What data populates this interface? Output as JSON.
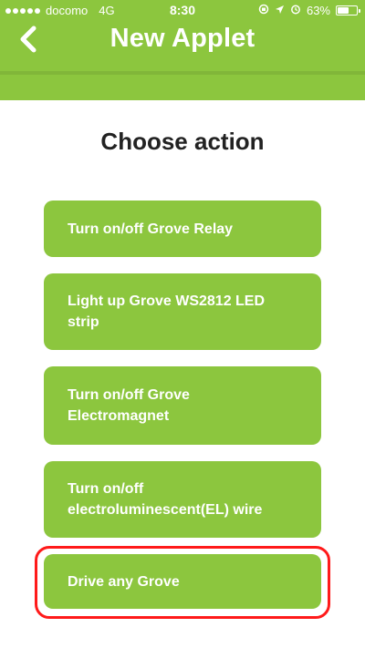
{
  "colors": {
    "brand": "#8cc63e",
    "highlight": "#ff1a1a",
    "text": "#222222"
  },
  "status_bar": {
    "carrier": "docomo",
    "network": "4G",
    "time": "8:30",
    "battery_percent": "63%",
    "battery_level": 0.63
  },
  "header": {
    "back_icon": "chevron-left-icon",
    "title": "New Applet"
  },
  "main": {
    "heading": "Choose action",
    "actions": [
      {
        "label": "Turn on/off Grove Relay"
      },
      {
        "label": "Light up Grove WS2812 LED strip"
      },
      {
        "label": "Turn on/off Grove Electromagnet"
      },
      {
        "label": "Turn on/off electroluminescent(EL) wire"
      },
      {
        "label": "Drive any Grove"
      }
    ],
    "highlighted_action": 4
  }
}
